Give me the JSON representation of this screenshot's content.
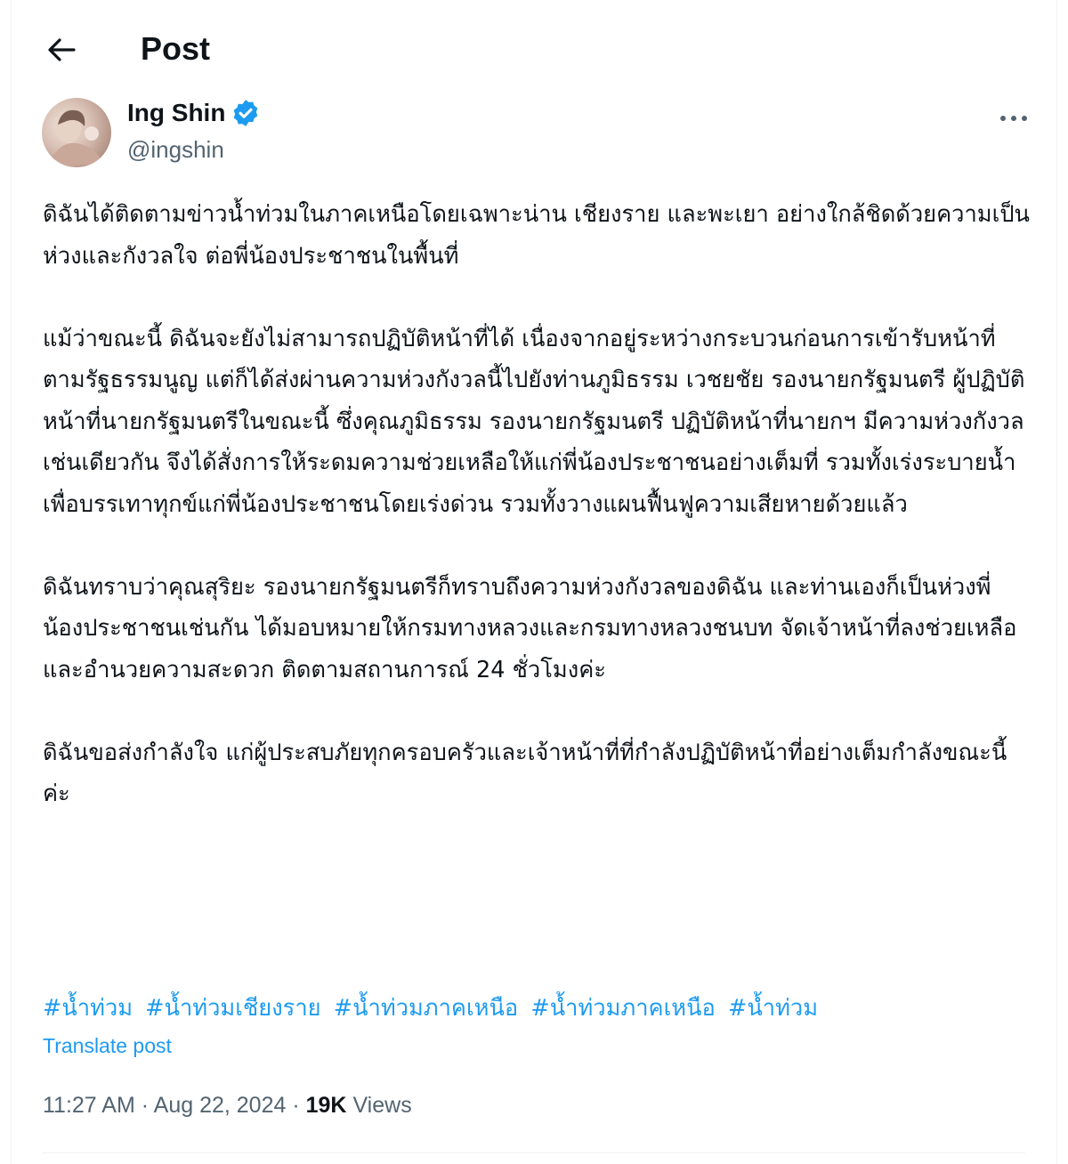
{
  "header": {
    "title": "Post"
  },
  "author": {
    "name": "Ing Shin",
    "handle": "@ingshin",
    "verified": true,
    "verified_color": "#1d9bf0"
  },
  "post": {
    "paragraphs": [
      "ดิฉันได้ติดตามข่าวน้ำท่วมในภาคเหนือโดยเฉพาะน่าน เชียงราย และพะเยา อย่างใกล้ชิดด้วยความเป็นห่วงและกังวลใจ ต่อพี่น้องประชาชนในพื้นที่",
      "แม้ว่าขณะนี้ ดิฉันจะยังไม่สามารถปฏิบัติหน้าที่ได้ เนื่องจากอยู่ระหว่างกระบวนก่อนการเข้ารับหน้าที่ตามรัฐธรรมนูญ แต่ก็ได้ส่งผ่านความห่วงกังวลนี้ไปยังท่านภูมิธรรม เวชยชัย รองนายกรัฐมนตรี ผู้ปฏิบัติหน้าที่นายกรัฐมนตรีในขณะนี้  ซึ่งคุณภูมิธรรม รองนายกรัฐมนตรี ปฏิบัติหน้าที่นายกฯ มีความห่วงกังวลเช่นเดียวกัน จึงได้สั่งการให้ระดมความช่วยเหลือให้แก่พี่น้องประชาชนอย่างเต็มที่ รวมทั้งเร่งระบายน้ำเพื่อบรรเทาทุกข์แก่พี่น้องประชาชนโดยเร่งด่วน รวมทั้งวางแผนฟื้นฟูความเสียหายด้วยแล้ว",
      "ดิฉันทราบว่าคุณสุริยะ รองนายกรัฐมนตรีก็ทราบถึงความห่วงกังวลของดิฉัน และท่านเองก็เป็นห่วงพี่น้องประชาชนเช่นกัน ได้มอบหมายให้กรมทางหลวงและกรมทางหลวงชนบท จัดเจ้าหน้าที่ลงช่วยเหลือและอำนวยความสะดวก ติดตามสถานการณ์ 24 ชั่วโมงค่ะ",
      "ดิฉันขอส่งกำลังใจ แก่ผู้ประสบภัยทุกครอบครัวและเจ้าหน้าที่ที่กำลังปฏิบัติหน้าที่อย่างเต็มกำลังขณะนี้ค่ะ"
    ],
    "hashtags": [
      "#น้ำท่วม",
      "#น้ำท่วมเชียงราย",
      "#น้ำท่วมภาคเหนือ",
      "#น้ำท่วมภาคเหนือ",
      "#น้ำท่วม"
    ],
    "translate_label": "Translate post",
    "time": "11:27 AM",
    "separator": "·",
    "date": "Aug 22, 2024",
    "views_count": "19K",
    "views_label": "Views"
  },
  "icons": {
    "back": "arrow-left-icon",
    "more": "more-horizontal-icon",
    "verified": "verified-badge-icon"
  },
  "colors": {
    "text_primary": "#0f1419",
    "text_secondary": "#536471",
    "accent": "#1d9bf0"
  }
}
